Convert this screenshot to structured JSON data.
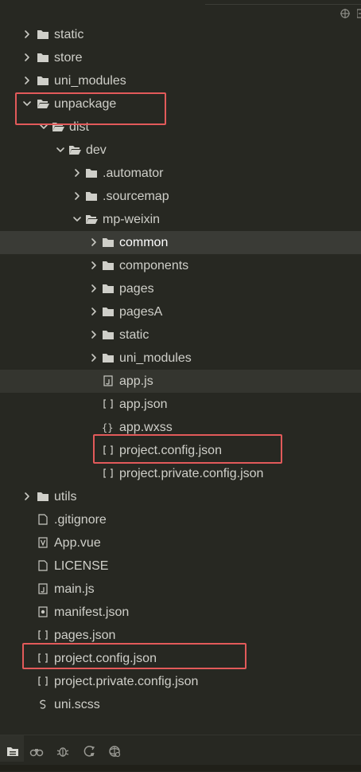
{
  "tree": [
    {
      "label": "static",
      "type": "folder",
      "depth": 0,
      "expanded": false
    },
    {
      "label": "store",
      "type": "folder",
      "depth": 0,
      "expanded": false
    },
    {
      "label": "uni_modules",
      "type": "folder",
      "depth": 0,
      "expanded": false
    },
    {
      "label": "unpackage",
      "type": "folder",
      "depth": 0,
      "expanded": true,
      "highlighted": true
    },
    {
      "label": "dist",
      "type": "folder",
      "depth": 1,
      "expanded": true
    },
    {
      "label": "dev",
      "type": "folder",
      "depth": 2,
      "expanded": true
    },
    {
      "label": ".automator",
      "type": "folder",
      "depth": 3,
      "expanded": false
    },
    {
      "label": ".sourcemap",
      "type": "folder",
      "depth": 3,
      "expanded": false
    },
    {
      "label": "mp-weixin",
      "type": "folder",
      "depth": 3,
      "expanded": true
    },
    {
      "label": "common",
      "type": "folder",
      "depth": 4,
      "expanded": false,
      "selected": true
    },
    {
      "label": "components",
      "type": "folder",
      "depth": 4,
      "expanded": false
    },
    {
      "label": "pages",
      "type": "folder",
      "depth": 4,
      "expanded": false
    },
    {
      "label": "pagesA",
      "type": "folder",
      "depth": 4,
      "expanded": false
    },
    {
      "label": "static",
      "type": "folder",
      "depth": 4,
      "expanded": false
    },
    {
      "label": "uni_modules",
      "type": "folder",
      "depth": 4,
      "expanded": false
    },
    {
      "label": "app.js",
      "type": "js",
      "depth": 4,
      "hover": true
    },
    {
      "label": "app.json",
      "type": "json",
      "depth": 4
    },
    {
      "label": "app.wxss",
      "type": "css",
      "depth": 4
    },
    {
      "label": "project.config.json",
      "type": "json",
      "depth": 4,
      "highlighted": true
    },
    {
      "label": "project.private.config.json",
      "type": "json",
      "depth": 4
    },
    {
      "label": "utils",
      "type": "folder",
      "depth": 0,
      "expanded": false
    },
    {
      "label": ".gitignore",
      "type": "file",
      "depth": 0
    },
    {
      "label": "App.vue",
      "type": "vue",
      "depth": 0
    },
    {
      "label": "LICENSE",
      "type": "file",
      "depth": 0
    },
    {
      "label": "main.js",
      "type": "js",
      "depth": 0
    },
    {
      "label": "manifest.json",
      "type": "manifest",
      "depth": 0
    },
    {
      "label": "pages.json",
      "type": "json",
      "depth": 0
    },
    {
      "label": "project.config.json",
      "type": "json",
      "depth": 0,
      "highlighted": true
    },
    {
      "label": "project.private.config.json",
      "type": "json",
      "depth": 0
    },
    {
      "label": "uni.scss",
      "type": "scss",
      "depth": 0
    }
  ],
  "topbar_icons": [
    "crosshair-icon",
    "collapse-icon"
  ],
  "bottombar_icons": [
    "explorer-icon",
    "search-binoculars-icon",
    "debug-icon",
    "source-control-icon",
    "extensions-icon"
  ],
  "colors": {
    "background": "#272822",
    "selected_row": "#3a3b36",
    "highlight_box": "#e25a5a",
    "text": "#cfcfc9"
  }
}
